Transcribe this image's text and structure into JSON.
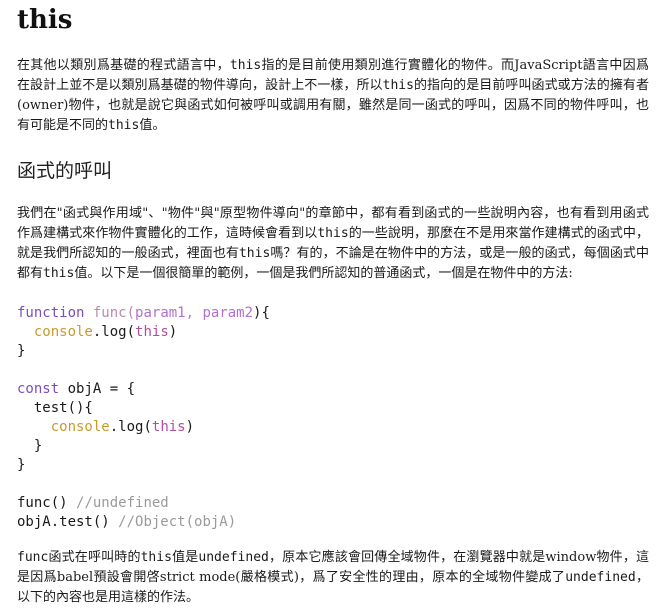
{
  "title": "this",
  "para1": {
    "s1": "在其他以類別爲基礎的程式語言中，",
    "c1": "this",
    "s2": "指的是目前使用類別進行實體化的物件。而JavaScript語言中因爲在設計上並不是以類別爲基礎的物件導向，設計上不一樣，所以",
    "c2": "this",
    "s3": "的指向的是目前呼叫函式或方法的擁有者(owner)物件，也就是說它與函式如何被呼叫或調用有關，雖然是同一函式的呼叫，因爲不同的物件呼叫，也有可能是不同的",
    "c3": "this",
    "s4": "值。"
  },
  "section_heading": "函式的呼叫",
  "para2": {
    "s1": "我們在\"函式與作用域\"、\"物件\"與\"原型物件導向\"的章節中，都有看到函式的一些說明內容，也有看到用函式作爲建構式來作物件實體化的工作，這時候會看到以",
    "c1": "this",
    "s2": "的一些說明，那麼在不是用來當作建構式的函式中，就是我們所認知的一般函式，裡面也有",
    "c2": "this",
    "s3": "嗎？有的，不論是在物件中的方法，或是一般的函式，每個函式中都有",
    "c3": "this",
    "s4": "值。以下是一個很簡單的範例，一個是我們所認知的普通函式，一個是在物件中的方法:"
  },
  "code": {
    "l1_kw": "function",
    "l1_fn": "func",
    "l1_open": "(",
    "l1_p1": "param1",
    "l1_comma": ", ",
    "l1_p2": "param2",
    "l1_close": "){",
    "l2_indent": "  ",
    "l2_obj": "console",
    "l2_mid": ".log(",
    "l2_this": "this",
    "l2_end": ")",
    "l3": "}",
    "l5_kw": "const",
    "l5_rest": " objA = {",
    "l6": "  test(){",
    "l7_indent": "    ",
    "l7_obj": "console",
    "l7_mid": ".log(",
    "l7_this": "this",
    "l7_end": ")",
    "l8": "  }",
    "l9": "}",
    "l11_code": "func() ",
    "l11_comment": "//undefined",
    "l12_code": "objA.test() ",
    "l12_comment": "//Object(objA)"
  },
  "para3": {
    "c1": "func",
    "s1": "函式在呼叫時的",
    "c2": "this",
    "s2": "值是",
    "c3": "undefined",
    "s3": "，原本它應該會回傳全域物件，在瀏覽器中就是window物件，這是因爲babel預設會開啓strict mode(嚴格模式)，爲了安全性的理由，原本的全域物件變成了",
    "c4": "undefined",
    "s4": "，以下的內容也是用這樣的作法。"
  }
}
